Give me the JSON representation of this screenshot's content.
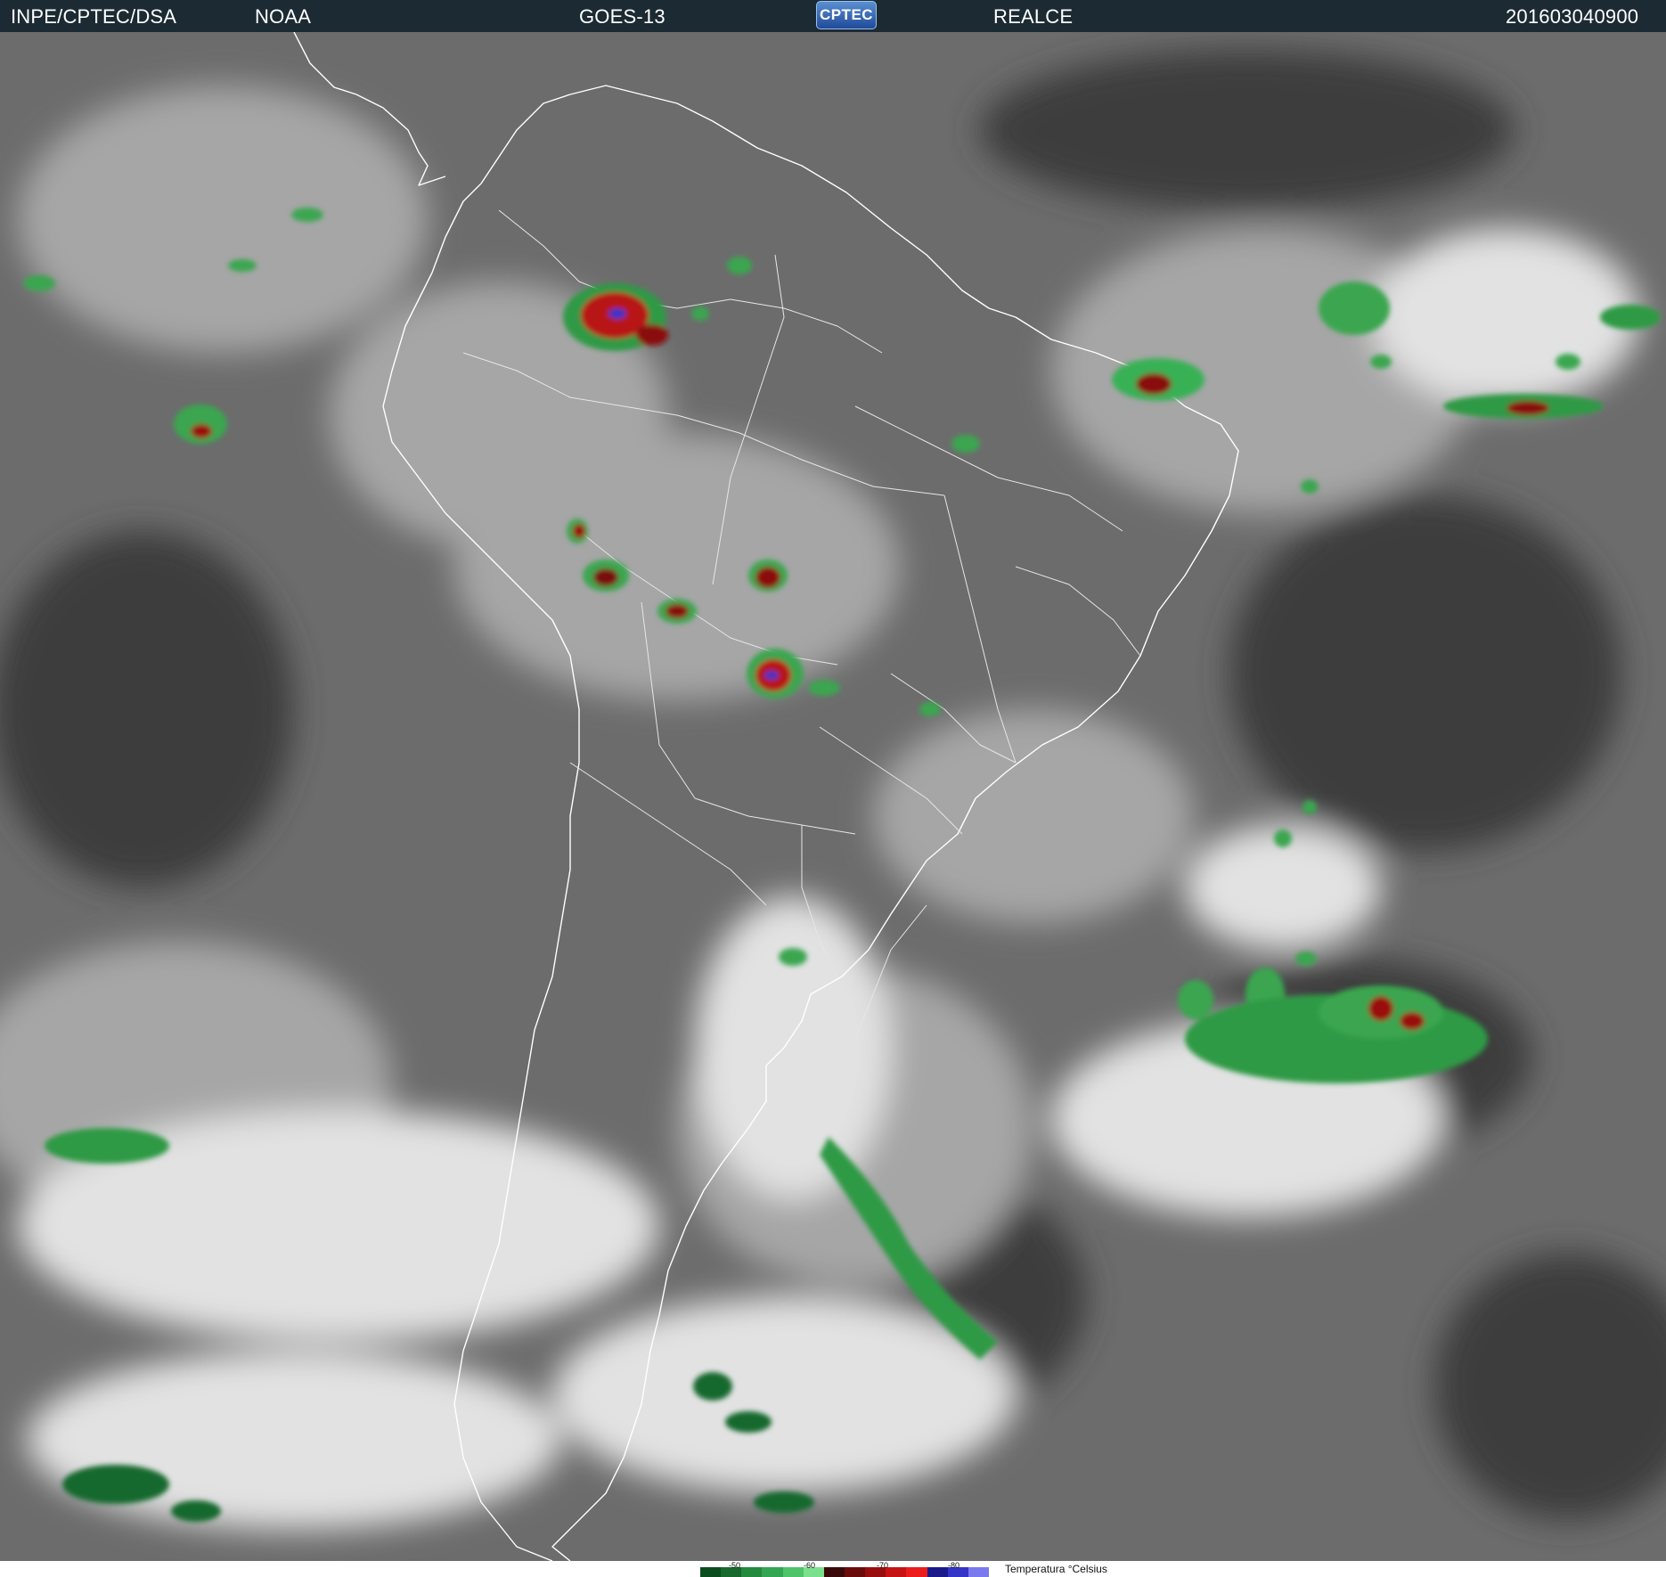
{
  "header": {
    "agency": "INPE/CPTEC/DSA",
    "provider": "NOAA",
    "satellite": "GOES-13",
    "logo_text": "CPTEC",
    "product": "REALCE",
    "timestamp": "201603040900"
  },
  "legend": {
    "title": "Temperatura °Celsius",
    "ticks": [
      "-50",
      "-60",
      "-70",
      "-80"
    ],
    "colors": [
      "#0b4d1f",
      "#17692e",
      "#238a3e",
      "#34a552",
      "#4fc46a",
      "#7be08d",
      "#3a0a0a",
      "#6b0c0c",
      "#980e0e",
      "#c61414",
      "#ec1c1c",
      "#1a1a8a",
      "#3434c8",
      "#7a7aee"
    ]
  },
  "map": {
    "background_color": "#6c6c6c",
    "coastline_color": "#ffffff"
  }
}
